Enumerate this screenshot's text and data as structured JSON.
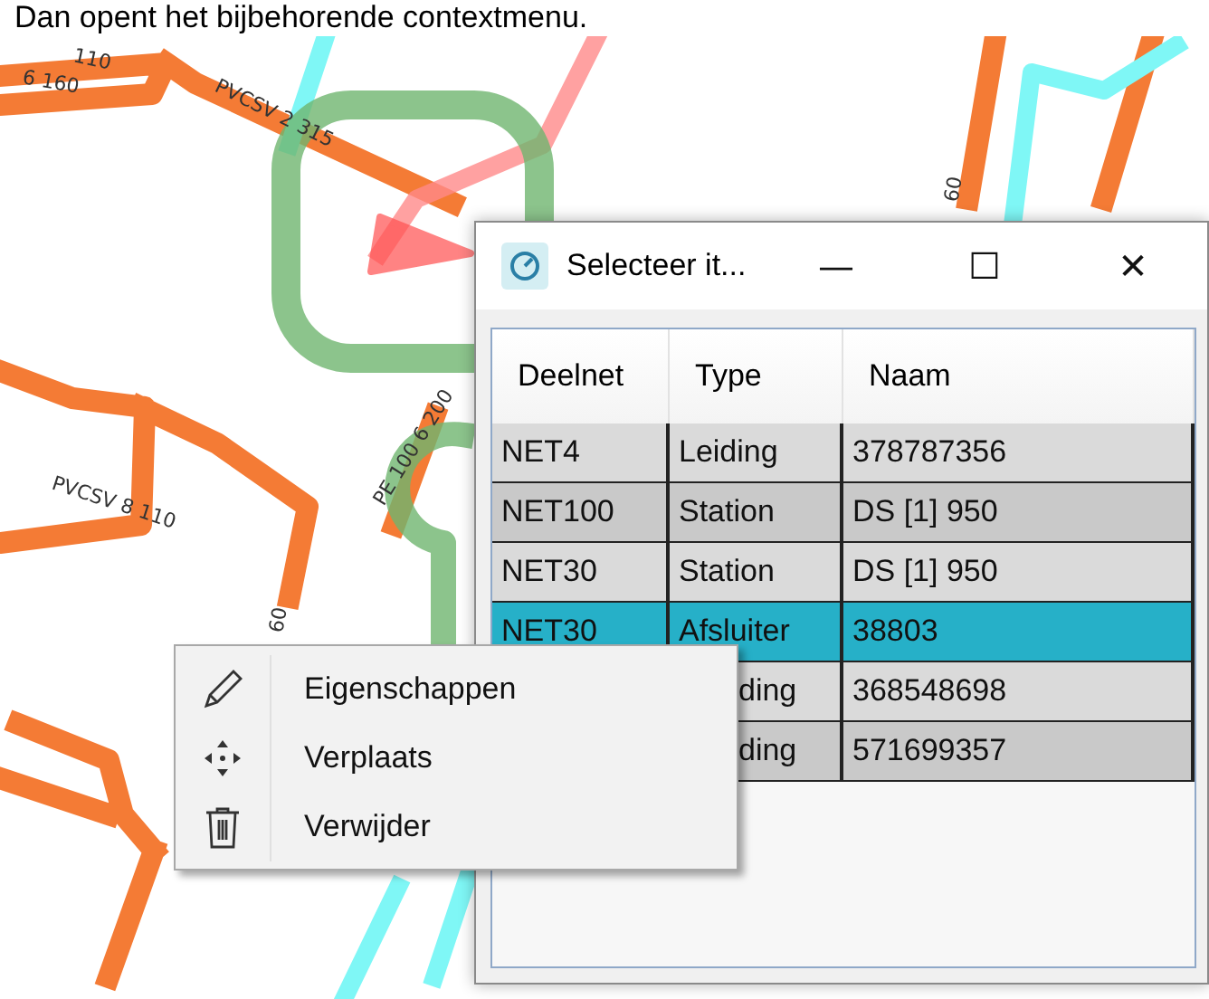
{
  "caption": "Dan opent het bijbehorende contextmenu.",
  "map": {
    "labels": [
      "110",
      "6 160",
      "PVCSV 2 315",
      "PE 100 6 200",
      "PVCSV 8 110",
      "60",
      "60"
    ]
  },
  "dialog": {
    "title": "Selecteer it...",
    "controls": [
      "—",
      "☐",
      "✕"
    ],
    "columns": [
      "Deelnet",
      "Type",
      "Naam"
    ],
    "rows": [
      {
        "deelnet": "NET4",
        "type": "Leiding",
        "naam": "378787356",
        "selected": false
      },
      {
        "deelnet": "NET100",
        "type": "Station",
        "naam": "DS [1] 950",
        "selected": false
      },
      {
        "deelnet": "NET30",
        "type": "Station",
        "naam": "DS [1] 950",
        "selected": false
      },
      {
        "deelnet": "NET30",
        "type": "Afsluiter",
        "naam": "38803",
        "selected": true
      },
      {
        "type": "ding",
        "naam": "368548698",
        "selected": false
      },
      {
        "type": "ding",
        "naam": "571699357",
        "selected": false
      }
    ]
  },
  "context_menu": {
    "items": [
      "Eigenschappen",
      "Verplaats",
      "Verwijder"
    ]
  }
}
